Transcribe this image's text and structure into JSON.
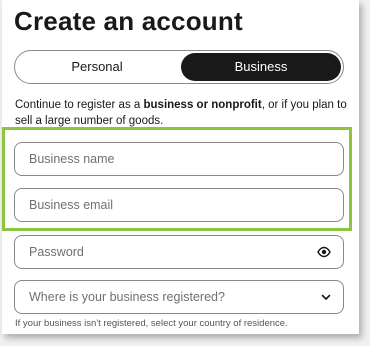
{
  "header": {
    "title": "Create an account"
  },
  "account_type": {
    "options": [
      "Personal",
      "Business"
    ],
    "selected": "Business"
  },
  "description": {
    "prefix": "Continue to register as a ",
    "bold": "business or nonprofit",
    "suffix": ", or if you plan to sell a large number of goods."
  },
  "form": {
    "business_name_placeholder": "Business name",
    "business_email_placeholder": "Business email",
    "password_placeholder": "Password",
    "country_placeholder": "Where is your business registered?",
    "country_note": "If your business isn't registered, select your country of residence."
  },
  "icons": {
    "password_toggle": "eye-icon",
    "dropdown": "chevron-down-icon"
  },
  "colors": {
    "highlight": "#8cc63f",
    "selected_toggle": "#191919"
  }
}
